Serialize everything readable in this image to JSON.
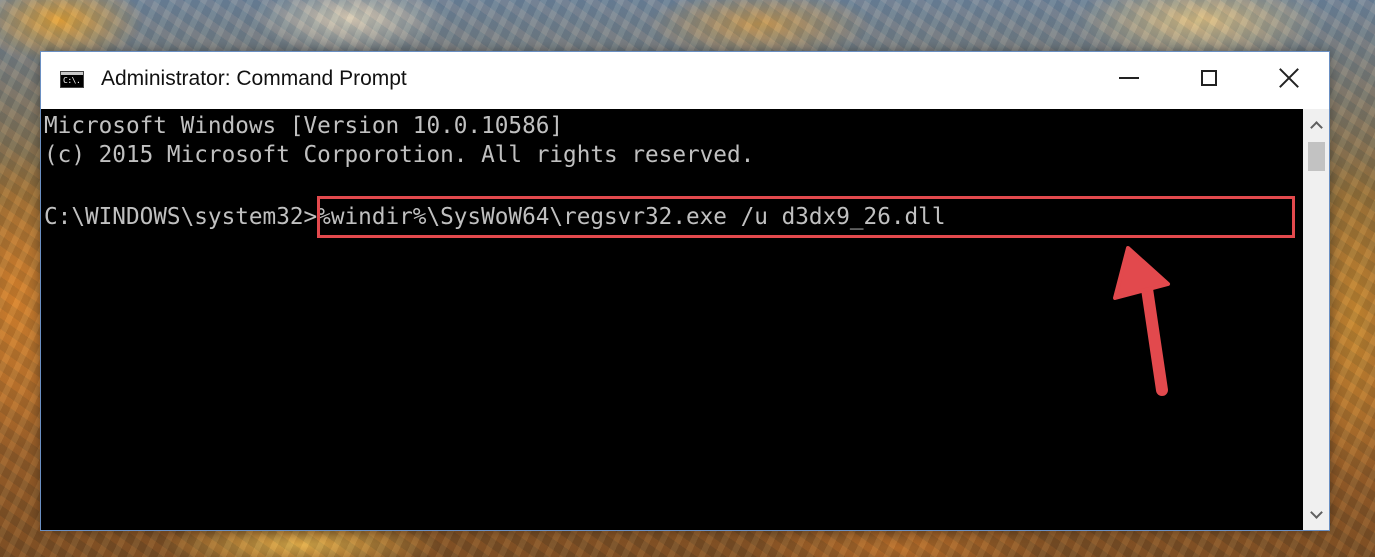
{
  "window": {
    "title": "Administrator: Command Prompt",
    "icon_name": "command-prompt-icon",
    "icon_text": "C:\\."
  },
  "console": {
    "lines": [
      "Microsoft Windows [Version 10.0.10586]",
      "(c) 2015 Microsoft Corporotion. All rights reserved.",
      "C:\\WINDOWS\\system32>%windir%\\SysWoW64\\regsvr32.exe /u d3dx9_26.dll"
    ],
    "text_color": "#c0c0c0",
    "background_color": "#000000"
  },
  "annotation": {
    "highlight_color": "#e2494d",
    "arrow_color": "#e2494d"
  }
}
